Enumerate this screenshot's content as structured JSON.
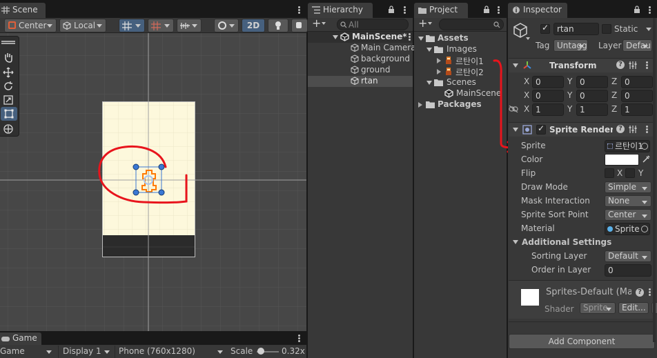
{
  "scene": {
    "tab_label": "Scene",
    "pivot_label": "Center",
    "space_label": "Local",
    "mode_2d_label": "2D"
  },
  "game": {
    "tab_label": "Game",
    "view_label": "Game",
    "display_label": "Display 1",
    "resolution_label": "Phone (760x1280)",
    "scale_label": "Scale",
    "scale_value": "0.32x",
    "scale_fraction": 0.2
  },
  "hierarchy": {
    "tab_label": "Hierarchy",
    "search_placeholder": "All",
    "add_label": "+",
    "scene_name": "MainScene*",
    "items": [
      "Main Camera",
      "background",
      "ground",
      "rtan"
    ],
    "selected": "rtan"
  },
  "project": {
    "tab_label": "Project",
    "add_label": "+",
    "assets_label": "Assets",
    "images_label": "Images",
    "image_items": [
      "르탄이1",
      "르탄이2"
    ],
    "scenes_label": "Scenes",
    "scene_item": "MainScene",
    "packages_label": "Packages"
  },
  "inspector": {
    "tab_label": "Inspector",
    "object_name": "rtan",
    "static_label": "Static",
    "tag_label": "Tag",
    "tag_value": "Untagged",
    "layer_label": "Layer",
    "layer_value": "Default",
    "transform": {
      "title": "Transform",
      "rows": [
        {
          "x": "0",
          "y": "0",
          "z": "0"
        },
        {
          "x": "0",
          "y": "0",
          "z": "0"
        },
        {
          "x": "1",
          "y": "1",
          "z": "1"
        }
      ],
      "x_label": "X",
      "y_label": "Y",
      "z_label": "Z"
    },
    "sprite_renderer": {
      "title": "Sprite Renderer",
      "sprite_label": "Sprite",
      "sprite_value": "르탄이1",
      "color_label": "Color",
      "color_value": "#ffffff",
      "flip_label": "Flip",
      "flip_x": "X",
      "flip_y": "Y",
      "draw_mode_label": "Draw Mode",
      "draw_mode_value": "Simple",
      "mask_label": "Mask Interaction",
      "mask_value": "None",
      "sort_point_label": "Sprite Sort Point",
      "sort_point_value": "Center",
      "material_label": "Material",
      "material_value": "Sprite",
      "additional_label": "Additional Settings",
      "sorting_layer_label": "Sorting Layer",
      "sorting_layer_value": "Default",
      "order_label": "Order in Layer",
      "order_value": "0"
    },
    "material": {
      "name": "Sprites-Default (Material)",
      "shader_label": "Shader",
      "shader_value": "Sprite",
      "edit_label": "Edit..."
    },
    "add_component_label": "Add Component"
  },
  "colors": {
    "accent_blue": "#3c5b8a",
    "annotation_red": "#e8141c",
    "canvas_bg": "#fdf8dc",
    "selection_orange": "#ff7a00"
  }
}
